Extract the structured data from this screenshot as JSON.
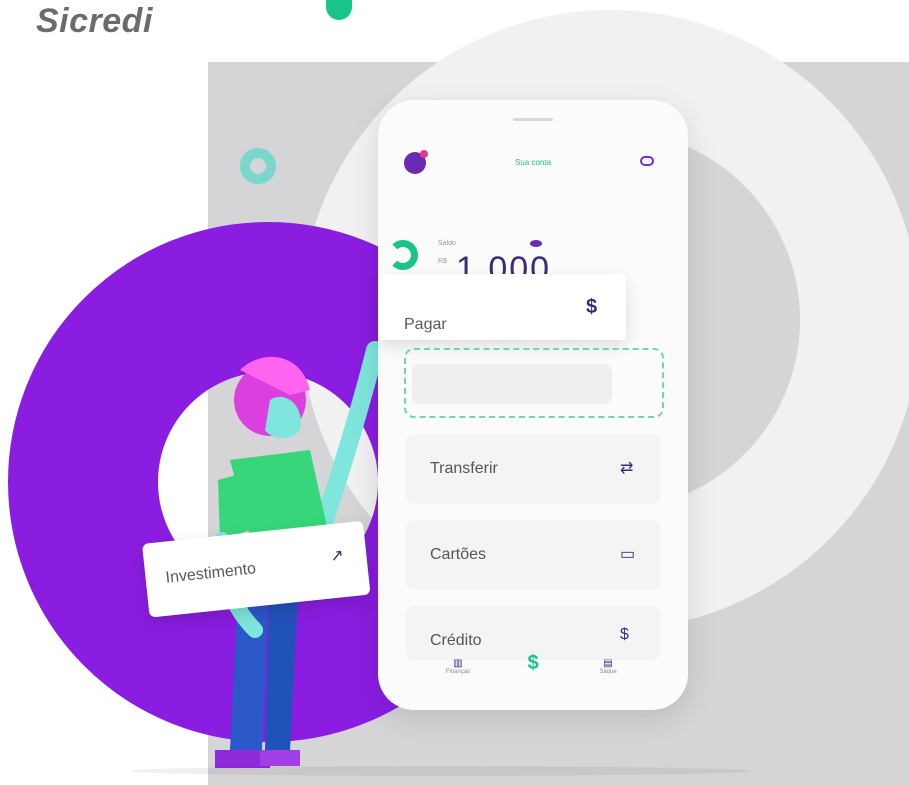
{
  "brand": {
    "logo_text": "Sicredi"
  },
  "phone": {
    "header_title": "Sua conta",
    "balance_label": "Saldo",
    "balance_currency": "R$",
    "balance_value": "1.000"
  },
  "actions": [
    {
      "label": "Pagar",
      "icon": "$"
    },
    {
      "label": "Transferir",
      "icon": "⇄"
    },
    {
      "label": "Cartões",
      "icon": "▭"
    },
    {
      "label": "Crédito",
      "icon": "$"
    }
  ],
  "floating_card": {
    "label": "Investimento",
    "icon": "↗"
  },
  "tabbar": [
    {
      "label": "Finanças"
    },
    {
      "label": "$"
    },
    {
      "label": "Saque"
    }
  ],
  "colors": {
    "purple": "#8a1de0",
    "green": "#19c48a",
    "teal": "#79d7cc",
    "gray_bg": "#d5d5d8"
  }
}
